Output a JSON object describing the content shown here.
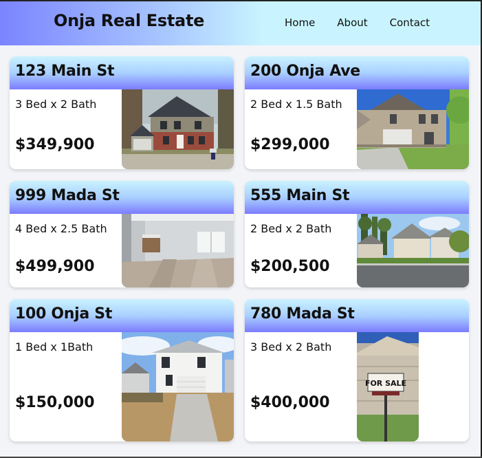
{
  "header": {
    "brand": "Onja Real Estate",
    "nav": [
      "Home",
      "About",
      "Contact"
    ]
  },
  "listings": [
    {
      "address": "123 Main St",
      "beds": "3 Bed x 2 Bath",
      "price": "$349,900",
      "photo": "two-story-brick-house-photo"
    },
    {
      "address": "200 Onja Ave",
      "beds": "2 Bed x 1.5 Bath",
      "price": "$299,000",
      "photo": "beige-house-with-lawn-photo"
    },
    {
      "address": "999 Mada St",
      "beds": "4 Bed x 2.5 Bath",
      "price": "$499,900",
      "photo": "empty-interior-living-room-photo"
    },
    {
      "address": "555 Main St",
      "beds": "2 Bed x 2 Bath",
      "price": "$200,500",
      "photo": "street-with-houses-photo"
    },
    {
      "address": "100 Onja St",
      "beds": "1 Bed x 1Bath",
      "price": "$150,000",
      "photo": "new-white-house-photo"
    },
    {
      "address": "780 Mada St",
      "beds": "3 Bed x 2 Bath",
      "price": "$400,000",
      "photo": "for-sale-sign-photo"
    }
  ],
  "photo_text": {
    "for_sale_sign": "FOR SALE"
  }
}
